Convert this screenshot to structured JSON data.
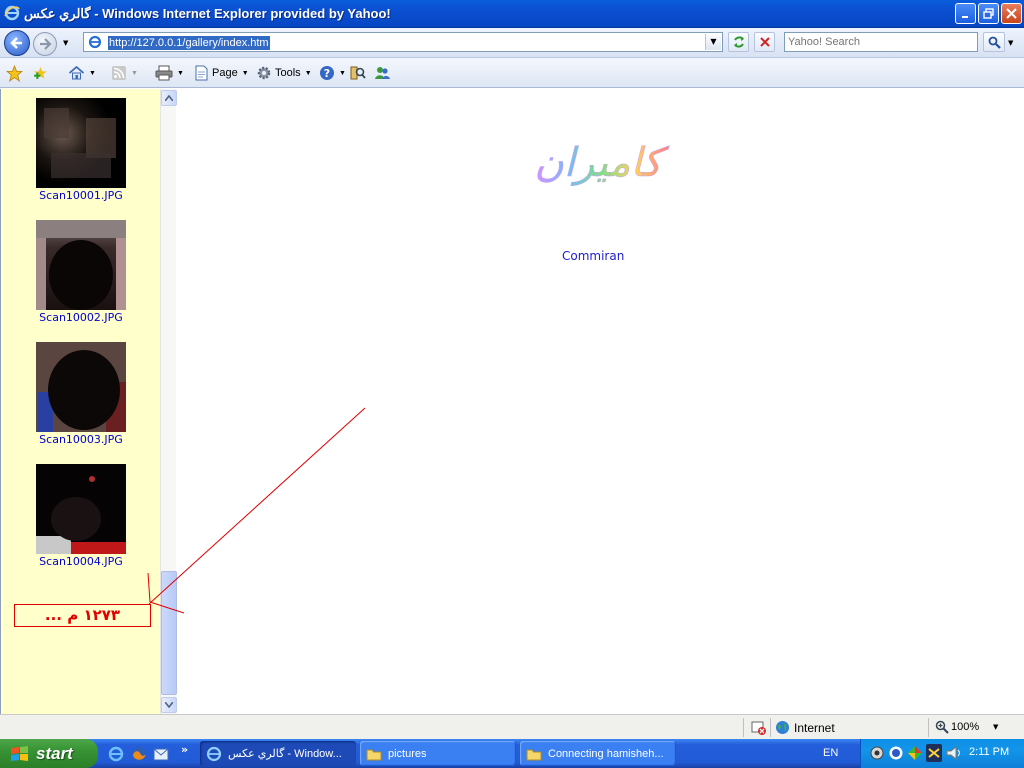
{
  "window": {
    "title": "گالري عكس - Windows Internet Explorer provided by Yahoo!"
  },
  "nav": {
    "url": "http://127.0.0.1/gallery/index.htm",
    "search_placeholder": "Yahoo! Search"
  },
  "commandbar": {
    "page_label": "Page",
    "tools_label": "Tools"
  },
  "gallery": {
    "items": [
      {
        "label": "Scan10001.JPG"
      },
      {
        "label": "Scan10002.JPG"
      },
      {
        "label": "Scan10003.JPG"
      },
      {
        "label": "Scan10004.JPG"
      }
    ],
    "counter_text": "۱۲۷۳ م ..."
  },
  "main": {
    "logo_text": "كاميران",
    "link_label": "Commiran"
  },
  "status": {
    "zone": "Internet",
    "zoom": "100%"
  },
  "taskbar": {
    "start_label": "start",
    "tasks": [
      {
        "label": "گالري عكس - Window..."
      },
      {
        "label": "pictures"
      },
      {
        "label": "Connecting hamisheh..."
      }
    ],
    "language": "EN",
    "clock": "2:11 PM"
  },
  "colors": {
    "accent": "#0b4fd0",
    "frame_bg": "#ffffcc",
    "link": "#0000cc",
    "annotation": "#e00000"
  }
}
